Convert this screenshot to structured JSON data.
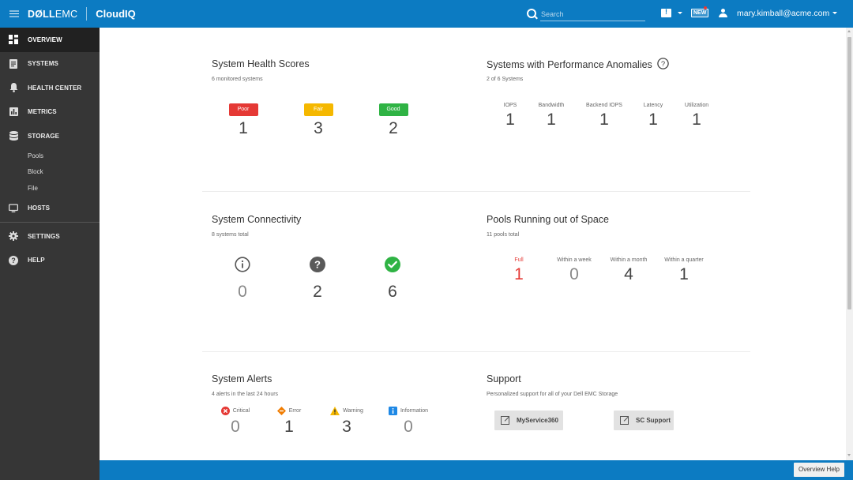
{
  "topbar": {
    "logo_dell": "DØLL",
    "logo_emc": "EMC",
    "product": "CloudIQ",
    "search_placeholder": "Search",
    "new_badge": "NEW",
    "user": "mary.kimball@acme.com"
  },
  "sidebar": {
    "items": [
      {
        "label": "OVERVIEW",
        "icon": "dashboard-icon"
      },
      {
        "label": "SYSTEMS",
        "icon": "document-icon"
      },
      {
        "label": "HEALTH CENTER",
        "icon": "bell-icon"
      },
      {
        "label": "METRICS",
        "icon": "bar-chart-icon"
      },
      {
        "label": "STORAGE",
        "icon": "database-icon"
      },
      {
        "label": "HOSTS",
        "icon": "monitor-icon"
      },
      {
        "label": "SETTINGS",
        "icon": "gear-icon"
      },
      {
        "label": "HELP",
        "icon": "help-icon"
      }
    ],
    "storage_subitems": [
      "Pools",
      "Block",
      "File"
    ]
  },
  "health": {
    "title": "System Health Scores",
    "subtitle": "6 monitored systems",
    "scores": [
      {
        "label": "Poor",
        "value": "1",
        "color": "#e53935"
      },
      {
        "label": "Fair",
        "value": "3",
        "color": "#f5b800"
      },
      {
        "label": "Good",
        "value": "2",
        "color": "#2fb344"
      }
    ]
  },
  "anomalies": {
    "title": "Systems with Performance Anomalies",
    "subtitle": "2 of 6 Systems",
    "metrics": [
      {
        "label": "IOPS",
        "value": "1"
      },
      {
        "label": "Bandwidth",
        "value": "1"
      },
      {
        "label": "Backend IOPS",
        "value": "1"
      },
      {
        "label": "Latency",
        "value": "1"
      },
      {
        "label": "Utilization",
        "value": "1"
      }
    ]
  },
  "connectivity": {
    "title": "System Connectivity",
    "subtitle": "8 systems total",
    "states": [
      {
        "icon": "info-outline-icon",
        "value": "0"
      },
      {
        "icon": "question-icon",
        "value": "2"
      },
      {
        "icon": "check-circle-icon",
        "value": "6"
      }
    ]
  },
  "pools": {
    "title": "Pools Running out of Space",
    "subtitle": "11 pools total",
    "metrics": [
      {
        "label": "Full",
        "value": "1",
        "color": "#e53935"
      },
      {
        "label": "Within a week",
        "value": "0"
      },
      {
        "label": "Within a month",
        "value": "4"
      },
      {
        "label": "Within a quarter",
        "value": "1"
      }
    ]
  },
  "alerts": {
    "title": "System Alerts",
    "subtitle": "4 alerts in the last 24 hours",
    "levels": [
      {
        "label": "Critical",
        "value": "0",
        "icon": "critical-icon",
        "color": "#e53935"
      },
      {
        "label": "Error",
        "value": "1",
        "icon": "error-icon",
        "color": "#f07c00"
      },
      {
        "label": "Warning",
        "value": "3",
        "icon": "warning-icon",
        "color": "#f5b800"
      },
      {
        "label": "Information",
        "value": "0",
        "icon": "info-icon",
        "color": "#1e88e5"
      }
    ]
  },
  "support": {
    "title": "Support",
    "subtitle": "Personalized support for all of your Dell EMC Storage",
    "buttons": [
      "MyService360",
      "SC Support"
    ]
  },
  "footer": {
    "help_button": "Overview Help"
  }
}
